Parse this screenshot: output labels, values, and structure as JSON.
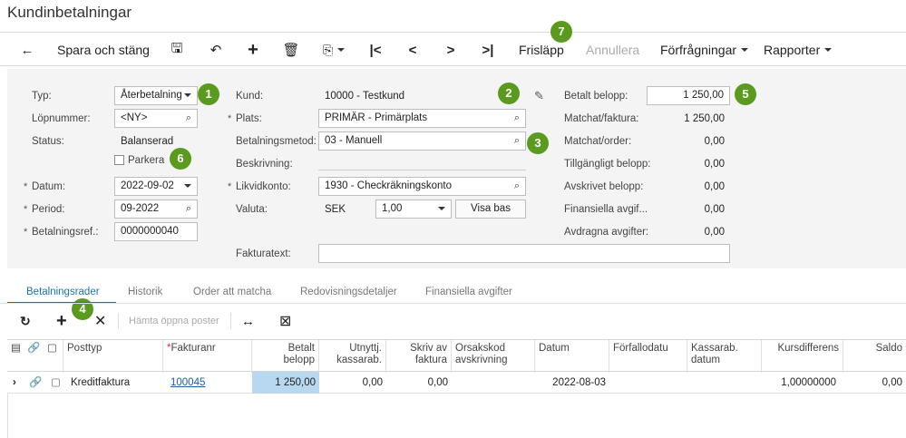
{
  "page_title": "Kundinbetalningar",
  "toolbar": {
    "back": "←",
    "save_close": "Spara och stäng",
    "save_icon": "🖫",
    "undo_icon": "↶",
    "add_icon": "+",
    "delete_icon": "🗑",
    "copy_icon": "⎘",
    "first_icon": "|<",
    "prev_icon": "<",
    "next_icon": ">",
    "last_icon": ">|",
    "release": "Frisläpp",
    "cancel": "Annullera",
    "inquiries": "Förfrågningar",
    "reports": "Rapporter"
  },
  "form": {
    "type_label": "Typ:",
    "type_value": "Återbetalning",
    "number_label": "Löpnummer:",
    "number_value": "<NY>",
    "status_label": "Status:",
    "status_value": "Balanserad",
    "hold_label": "Parkera",
    "date_label": "Datum:",
    "date_value": "2022-09-02",
    "period_label": "Period:",
    "period_value": "09-2022",
    "payref_label": "Betalningsref.:",
    "payref_value": "0000000040",
    "customer_label": "Kund:",
    "customer_value": "10000 - Testkund",
    "location_label": "Plats:",
    "location_value": "PRIMÄR - Primärplats",
    "method_label": "Betalningsmetod:",
    "method_value": "03 - Manuell",
    "desc_label": "Beskrivning:",
    "desc_value": "",
    "cash_label": "Likvidkonto:",
    "cash_value": "1930 - Checkräkningskonto",
    "currency_label": "Valuta:",
    "currency_value": "SEK",
    "rate_value": "1,00",
    "view_base": "Visa bas",
    "invoice_text_label": "Fakturatext:",
    "invoice_text_value": "",
    "paid_amount_label": "Betalt belopp:",
    "paid_amount_value": "1 250,00",
    "applied_invoice_label": "Matchat/faktura:",
    "applied_invoice_value": "1 250,00",
    "applied_order_label": "Matchat/order:",
    "applied_order_value": "0,00",
    "available_label": "Tillgängligt belopp:",
    "available_value": "0,00",
    "writeoff_label": "Avskrivet belopp:",
    "writeoff_value": "0,00",
    "fin_charges_label": "Finansiella avgif...",
    "fin_charges_value": "0,00",
    "deducted_label": "Avdragna avgifter:",
    "deducted_value": "0,00",
    "required_mark": "*"
  },
  "badges": [
    "1",
    "2",
    "3",
    "4",
    "5",
    "6",
    "7"
  ],
  "tabs": [
    "Betalningsrader",
    "Historik",
    "Order att matcha",
    "Redovisningsdetaljer",
    "Finansiella avgifter"
  ],
  "grid_toolbar": {
    "refresh_icon": "↻",
    "add_icon": "+",
    "delete_icon": "✕",
    "load_docs": "Hämta öppna poster",
    "fit_icon": "↔",
    "export_icon": "⊠"
  },
  "grid": {
    "columns": [
      "Posttyp",
      "Fakturanr",
      "Betalt belopp",
      "Utnyttj. kassarab.",
      "Skriv av faktura",
      "Orsakskod avskrivning",
      "Datum",
      "Förfallodatu",
      "Kassarab. datum",
      "Kursdifferens",
      "Saldo"
    ],
    "rows": [
      {
        "type": "Kreditfaktura",
        "ref": "100045",
        "paid": "1 250,00",
        "cashdisc": "0,00",
        "writeoff": "0,00",
        "reason": "",
        "date": "2022-08-03",
        "due": "",
        "cashdate": "",
        "rate": "1,00000000",
        "balance": "0,00"
      }
    ]
  }
}
